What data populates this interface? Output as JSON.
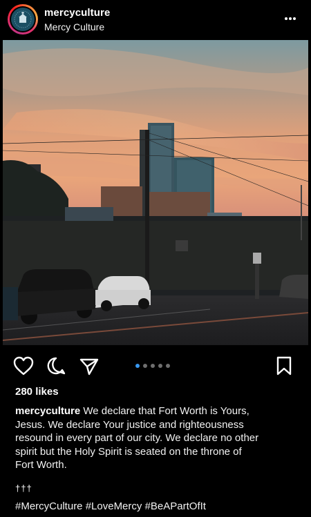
{
  "post": {
    "username": "mercyculture",
    "display_name": "Mercy Culture",
    "likes": "280 likes",
    "caption_username": "mercyculture",
    "caption_lines": [
      " We declare that Fort Worth is Yours,",
      "Jesus. We declare Your justice and righteousness",
      "resound in every part of our city. We declare no other",
      "spirit but the Holy Spirit is seated on the throne of",
      "Fort Worth."
    ],
    "crosses": "†††",
    "hashtags": "#MercyCulture #LoveMercy #BeAPartOfIt"
  },
  "carousel": {
    "total": 5,
    "active_index": 0
  },
  "icons": {
    "more": "more-options-icon",
    "like": "heart-icon",
    "comment": "comment-icon",
    "share": "send-icon",
    "save": "bookmark-icon"
  },
  "colors": {
    "background": "#000000",
    "text": "#ffffff",
    "carousel_active": "#3897f0",
    "carousel_inactive": "#6e6e6e"
  }
}
